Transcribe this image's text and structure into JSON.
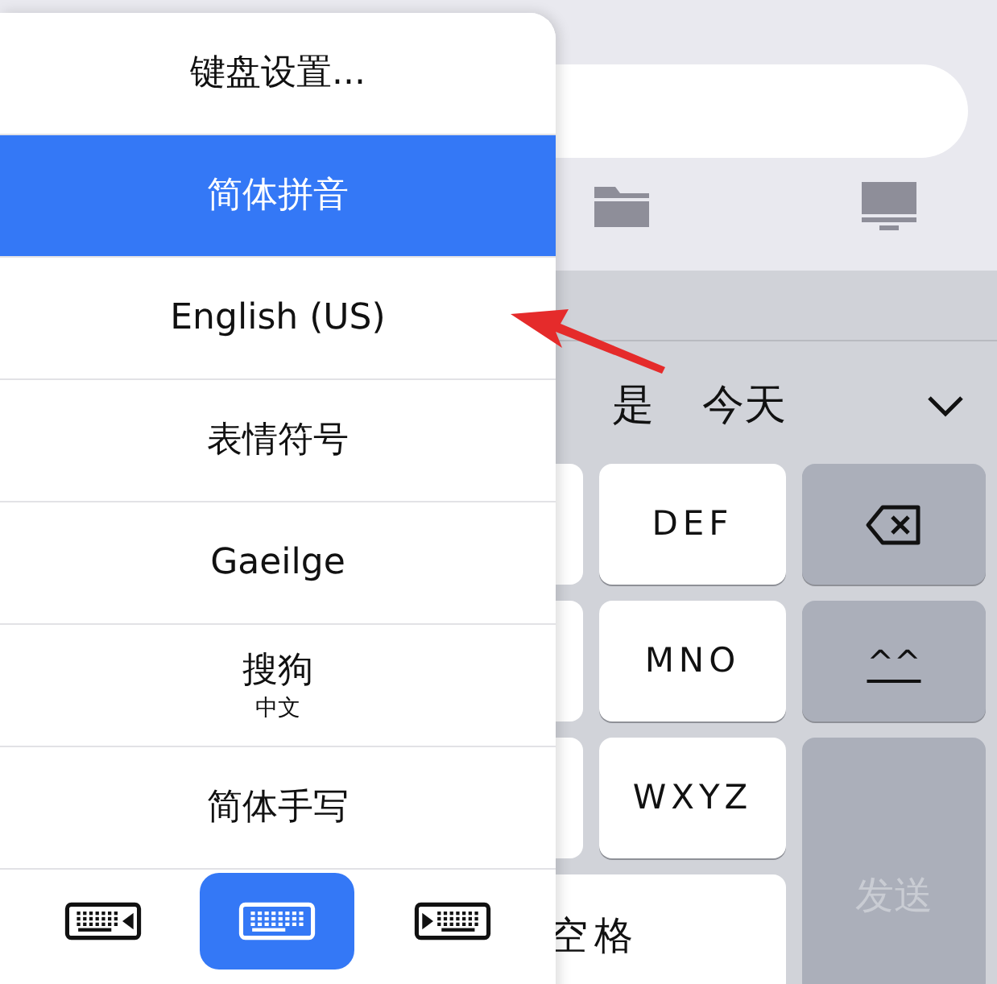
{
  "menu": {
    "items": [
      {
        "label": "键盘设置...",
        "selected": false
      },
      {
        "label": "简体拼音",
        "selected": true
      },
      {
        "label": "English (US)",
        "selected": false
      },
      {
        "label": "表情符号",
        "selected": false
      },
      {
        "label": "Gaeilge",
        "selected": false
      },
      {
        "label": "搜狗",
        "sublabel": "中文",
        "selected": false
      },
      {
        "label": "简体手写",
        "selected": false
      }
    ],
    "layout_options": [
      {
        "kind": "left",
        "selected": false
      },
      {
        "kind": "full",
        "selected": true
      },
      {
        "kind": "right",
        "selected": false
      }
    ]
  },
  "candidates": [
    "是",
    "今天"
  ],
  "keys": [
    {
      "kind": "letter",
      "label": "DEF"
    },
    {
      "kind": "delete"
    },
    {
      "kind": "letter",
      "label": "MNO"
    },
    {
      "kind": "symbol",
      "label": "^^"
    },
    {
      "kind": "letter",
      "label": "WXYZ"
    },
    {
      "kind": "send",
      "label": "发送"
    }
  ],
  "space_key": {
    "label": "空格"
  }
}
